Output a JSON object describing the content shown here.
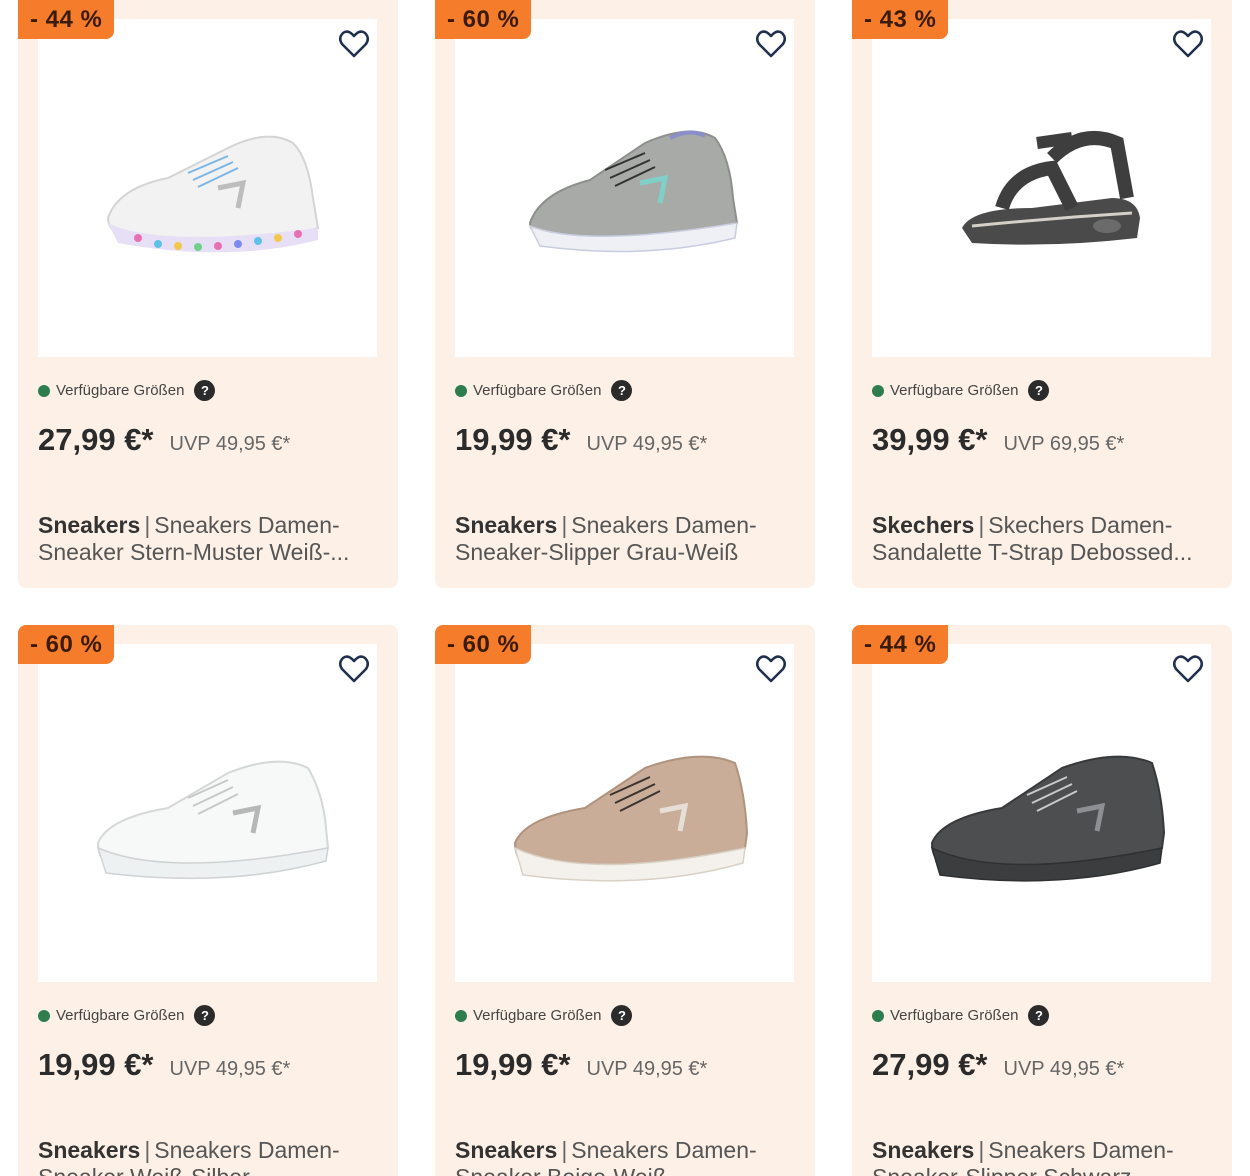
{
  "availability_label": "Verfügbare Größen",
  "help_glyph": "?",
  "colors": {
    "card_bg": "#fdf1e7",
    "badge": "#f47c2b",
    "available_dot": "#2e7d4f"
  },
  "products": [
    {
      "discount": "- 44 %",
      "price": "27,99 €*",
      "uvp": "UVP 49,95 €*",
      "brand": "Sneakers",
      "name": "Sneakers Damen-Sneaker Stern-Muster Weiß-...",
      "image": "white-sneaker-star-sole"
    },
    {
      "discount": "- 60 %",
      "price": "19,99 €*",
      "uvp": "UVP 49,95 €*",
      "brand": "Sneakers",
      "name": "Sneakers Damen-Sneaker-Slipper Grau-Weiß",
      "image": "grey-knit-sneaker"
    },
    {
      "discount": "- 43 %",
      "price": "39,99 €*",
      "uvp": "UVP 69,95 €*",
      "brand": "Skechers",
      "name": "Skechers Damen-Sandalette T-Strap Debossed...",
      "image": "dark-grey-sandal"
    },
    {
      "discount": "- 60 %",
      "price": "19,99 €*",
      "uvp": "UVP 49,95 €*",
      "brand": "Sneakers",
      "name": "Sneakers Damen-Sneaker Weiß-Silber",
      "image": "white-sneaker"
    },
    {
      "discount": "- 60 %",
      "price": "19,99 €*",
      "uvp": "UVP 49,95 €*",
      "brand": "Sneakers",
      "name": "Sneakers Damen-Sneaker Beige-Weiß",
      "image": "beige-sneaker"
    },
    {
      "discount": "- 44 %",
      "price": "27,99 €*",
      "uvp": "UVP 49,95 €*",
      "brand": "Sneakers",
      "name": "Sneakers Damen-Sneaker-Slipper Schwarz",
      "image": "black-sneaker"
    }
  ]
}
